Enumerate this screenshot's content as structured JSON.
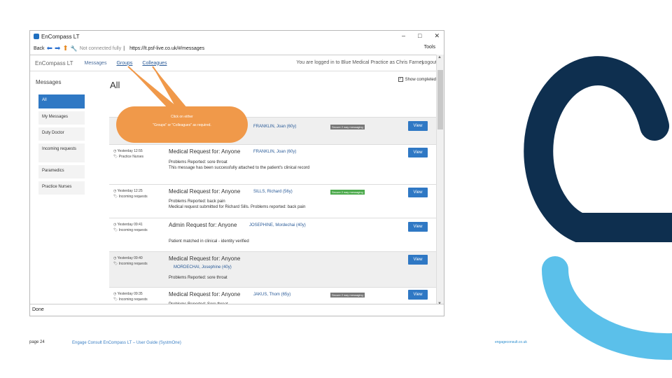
{
  "window": {
    "title": "EnCompass LT",
    "controls": [
      "–",
      "□",
      "✕"
    ]
  },
  "address": {
    "back_label": "Back",
    "not_secure": "Not connected fully",
    "url": "https://lt.psf-live.co.uk/#/messages",
    "tools_label": "Tools"
  },
  "appnav": {
    "brand": "EnCompass LT",
    "links": [
      "Messages",
      "Groups",
      "Colleagues"
    ],
    "login_info": "You are logged in to Blue Medical Practice as Chris Farney",
    "logout": "Logout"
  },
  "sidebar": {
    "title": "Messages",
    "items": [
      {
        "label": "All"
      },
      {
        "label": "My Messages"
      },
      {
        "label": "Duty Doctor"
      },
      {
        "label": "Incoming requests"
      },
      {
        "label": "Paramedics"
      },
      {
        "label": "Practice Nurses"
      }
    ]
  },
  "main": {
    "title": "All",
    "show_completed": "Show completed",
    "view_label": "View"
  },
  "messages": [
    {
      "time": "",
      "from": "",
      "title": "",
      "patient": "FRANKLIN, Joan (60y)",
      "badge": "Secure 2 way messaging",
      "details": []
    },
    {
      "time": "Yesterday 12:55",
      "from": "Practice Nurses",
      "title": "Medical Request for: Anyone",
      "patient": "FRANKLIN, Joan (60y)",
      "badge": "",
      "details": [
        "Problems Reported: sore throat",
        "This message has been successfully attached to the patient's clinical record"
      ]
    },
    {
      "time": "Yesterday 12:25",
      "from": "Incoming requests",
      "title": "Medical Request for: Anyone",
      "patient": "SILLS, Richard (56y)",
      "badge": "Secure 2 way messaging",
      "details": [
        "Problems Reported: back pain",
        "Medical request submitted for Richard Sills. Problems reported: back pain"
      ]
    },
    {
      "time": "Yesterday 09:41",
      "from": "Incoming requests",
      "title": "Admin Request for: Anyone",
      "patient": "JOSEPHINE, Mordechai (40y)",
      "badge": "",
      "details": [
        "Patient matched in clinical - identity verified"
      ]
    },
    {
      "time": "Yesterday 09:40",
      "from": "Incoming requests",
      "title": "Medical Request for: Anyone",
      "patient": "MORDECHAI, Josephine (40y)",
      "badge": "",
      "details": [
        "Problems Reported: sore throat"
      ]
    },
    {
      "time": "Yesterday 09:35",
      "from": "Incoming requests",
      "title": "Medical Request for: Anyone",
      "patient": "JAKUS, Thom (65y)",
      "badge": "Secure 2 way messaging",
      "details": [
        "Problems Reported: Sore throat"
      ]
    }
  ],
  "status": "Done",
  "callout": {
    "line1": "Click on either",
    "line2": "\"Groups\" or \"Colleagues\" as required."
  },
  "footer": {
    "page": "page 24",
    "title": "Engage Consult EnCompass LT – User Guide (SystmOne)",
    "url": "engageconsult.co.uk"
  },
  "colors": {
    "brand_navy": "#0e2f4f",
    "brand_light_blue": "#5bc0ea",
    "callout_orange": "#f0994a",
    "view_button_blue": "#2f78c4",
    "badge_green": "#4caa4c",
    "badge_grey": "#777777"
  },
  "icons": [
    "back-arrow-icon",
    "forward-arrow-icon",
    "home-icon",
    "lock-icon",
    "clock-icon",
    "tag-icon",
    "checkbox-icon"
  ]
}
